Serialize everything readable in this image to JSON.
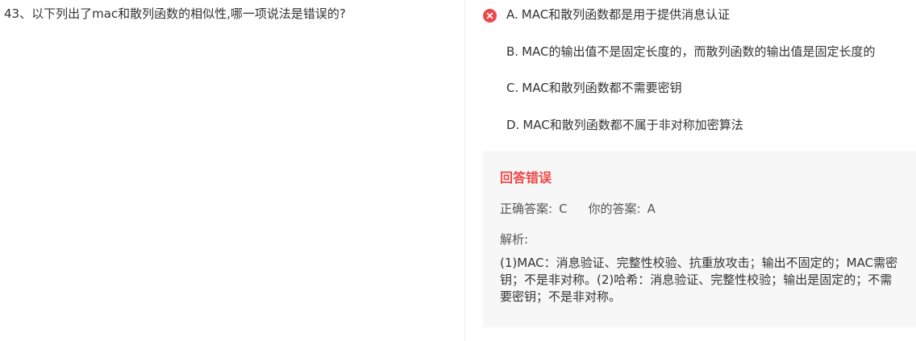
{
  "question": {
    "text": "43、以下列出了mac和散列函数的相似性,哪一项说法是错误的?"
  },
  "options": [
    {
      "letter": "A.",
      "text": "MAC和散列函数都是用于提供消息认证",
      "status": "wrong-selected"
    },
    {
      "letter": "B.",
      "text": "MAC的输出值不是固定长度的，而散列函数的输出值是固定长度的"
    },
    {
      "letter": "C.",
      "text": "MAC和散列函数都不需要密钥"
    },
    {
      "letter": "D.",
      "text": "MAC和散列函数都不属于非对称加密算法"
    }
  ],
  "result": {
    "title": "回答错误",
    "correct_label": "正确答案:",
    "correct_value": "C",
    "yours_label": "你的答案:",
    "yours_value": "A",
    "analysis_label": "解析:",
    "analysis_text": "(1)MAC：消息验证、完整性校验、抗重放攻击；输出不固定的；MAC需密钥；不是非对称。(2)哈希：消息验证、完整性校验；输出是固定的；不需要密钥；不是非对称。"
  },
  "icons": {
    "wrong": "close-circle-icon"
  },
  "colors": {
    "error": "#ee4747",
    "panel_bg": "#f7f7f7"
  }
}
